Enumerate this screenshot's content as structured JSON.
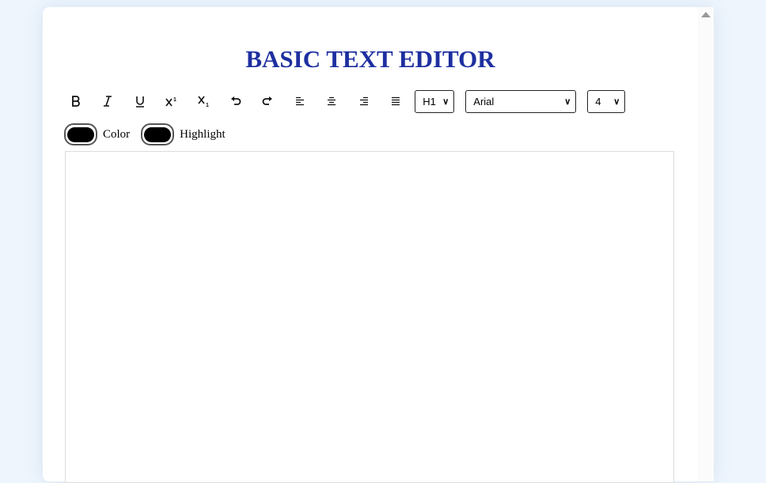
{
  "app": {
    "title": "BASIC TEXT EDITOR",
    "title_color": "#1e2fa0"
  },
  "toolbar": {
    "buttons": [
      {
        "name": "bold",
        "icon": "bold-icon"
      },
      {
        "name": "italic",
        "icon": "italic-icon"
      },
      {
        "name": "underline",
        "icon": "underline-icon"
      },
      {
        "name": "superscript",
        "icon": "superscript-icon"
      },
      {
        "name": "subscript",
        "icon": "subscript-icon"
      },
      {
        "name": "undo",
        "icon": "undo-icon"
      },
      {
        "name": "redo",
        "icon": "redo-icon"
      },
      {
        "name": "align-left",
        "icon": "align-left-icon"
      },
      {
        "name": "align-center",
        "icon": "align-center-icon"
      },
      {
        "name": "align-right",
        "icon": "align-right-icon"
      },
      {
        "name": "justify",
        "icon": "justify-icon"
      }
    ],
    "heading_select": {
      "value": "H1"
    },
    "font_select": {
      "value": "Arial"
    },
    "size_select": {
      "value": "4"
    }
  },
  "colors": {
    "color_label": "Color",
    "color_value": "#000000",
    "highlight_label": "Highlight",
    "highlight_value": "#000000"
  },
  "editor": {
    "content": ""
  }
}
